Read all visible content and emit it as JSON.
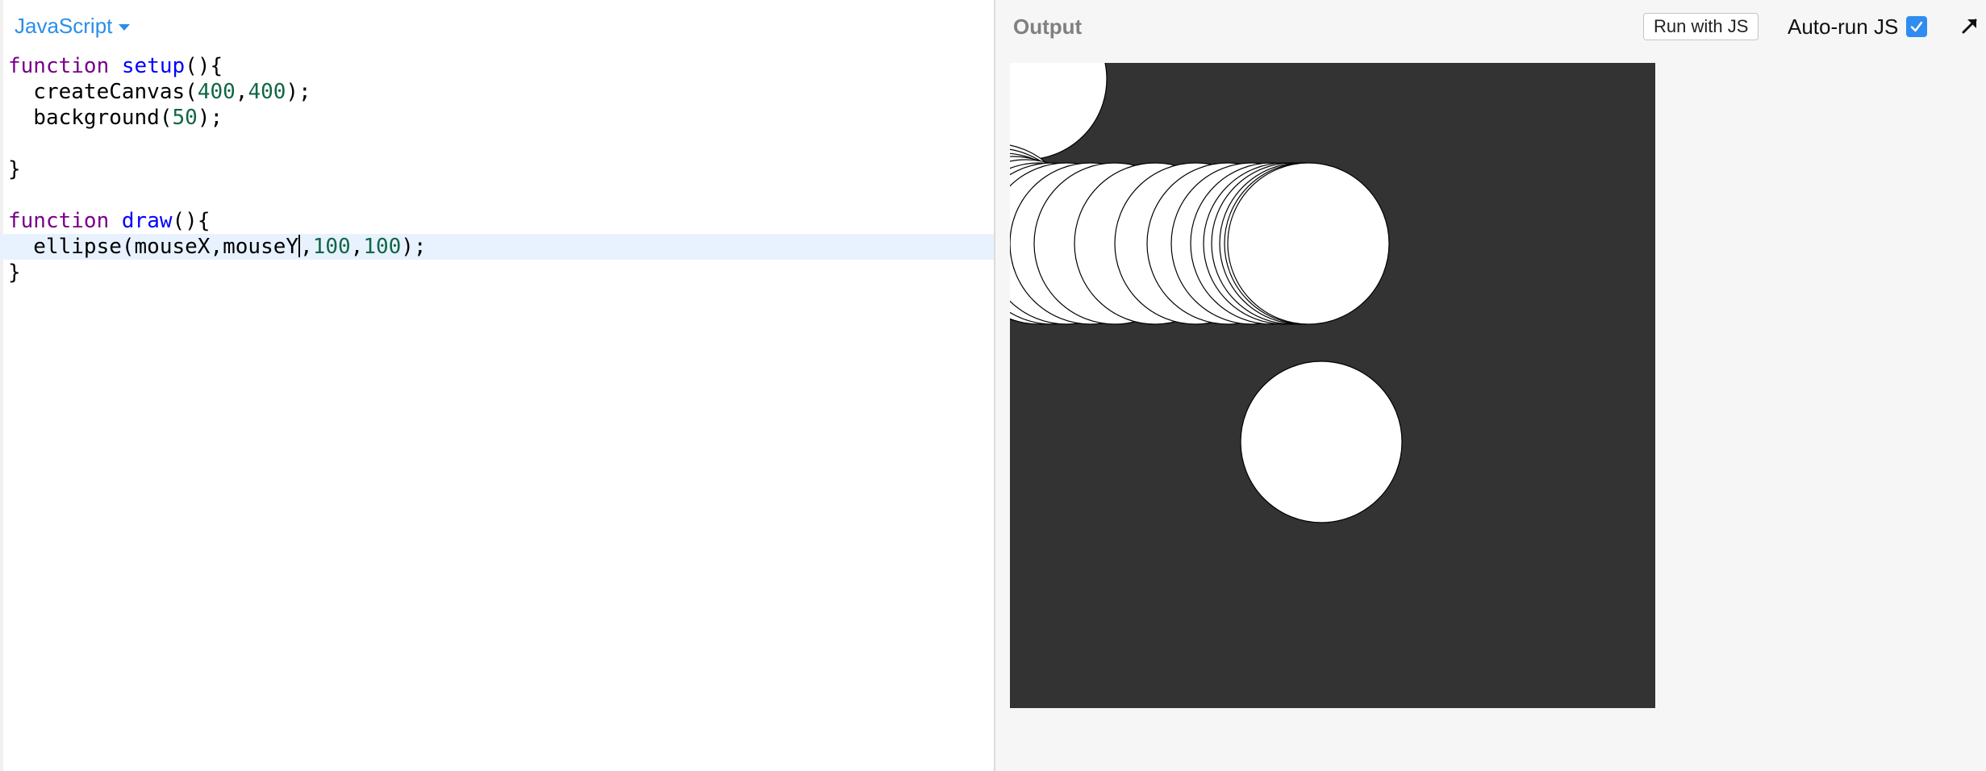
{
  "editor": {
    "language_label": "JavaScript",
    "lines": [
      [
        {
          "t": "kw",
          "v": "function"
        },
        {
          "t": "plain",
          "v": " "
        },
        {
          "t": "fn",
          "v": "setup"
        },
        {
          "t": "plain",
          "v": "(){"
        }
      ],
      [
        {
          "t": "plain",
          "v": "  createCanvas("
        },
        {
          "t": "num",
          "v": "400"
        },
        {
          "t": "plain",
          "v": ","
        },
        {
          "t": "num",
          "v": "400"
        },
        {
          "t": "plain",
          "v": ");"
        }
      ],
      [
        {
          "t": "plain",
          "v": "  background("
        },
        {
          "t": "num",
          "v": "50"
        },
        {
          "t": "plain",
          "v": ");"
        }
      ],
      [],
      [
        {
          "t": "plain",
          "v": "}"
        }
      ],
      [],
      [
        {
          "t": "kw",
          "v": "function"
        },
        {
          "t": "plain",
          "v": " "
        },
        {
          "t": "fn",
          "v": "draw"
        },
        {
          "t": "plain",
          "v": "(){"
        }
      ],
      [
        {
          "t": "plain",
          "v": "  ellipse(mouseX,mouseY"
        },
        {
          "t": "cursor",
          "v": ""
        },
        {
          "t": "plain",
          "v": ","
        },
        {
          "t": "num",
          "v": "100"
        },
        {
          "t": "plain",
          "v": ","
        },
        {
          "t": "num",
          "v": "100"
        },
        {
          "t": "plain",
          "v": ");"
        }
      ],
      [
        {
          "t": "plain",
          "v": "}"
        }
      ]
    ],
    "active_line": 7
  },
  "output": {
    "title": "Output",
    "run_label": "Run with JS",
    "autorun_label": "Auto-run JS",
    "autorun_checked": true
  },
  "canvas": {
    "width": 400,
    "height": 400,
    "background": "#333333",
    "fill": "#ffffff",
    "stroke": "#000000",
    "diameter": 100,
    "ellipses": [
      [
        10,
        10
      ],
      [
        -10,
        100
      ],
      [
        -8,
        103
      ],
      [
        -4,
        106
      ],
      [
        2,
        108
      ],
      [
        10,
        110
      ],
      [
        18,
        112
      ],
      [
        26,
        112
      ],
      [
        35,
        112
      ],
      [
        50,
        112
      ],
      [
        65,
        112
      ],
      [
        90,
        112
      ],
      [
        115,
        112
      ],
      [
        135,
        112
      ],
      [
        150,
        112
      ],
      [
        162,
        112
      ],
      [
        170,
        112
      ],
      [
        175,
        112
      ],
      [
        180,
        112
      ],
      [
        183,
        112
      ],
      [
        185,
        112
      ],
      [
        193,
        235
      ]
    ]
  },
  "colors": {
    "accent": "#2a8ee8",
    "keyword": "#770088",
    "function_name": "#0000ff",
    "number": "#116644",
    "active_line": "#e8f2ff",
    "checkbox": "#2f8cf0"
  }
}
